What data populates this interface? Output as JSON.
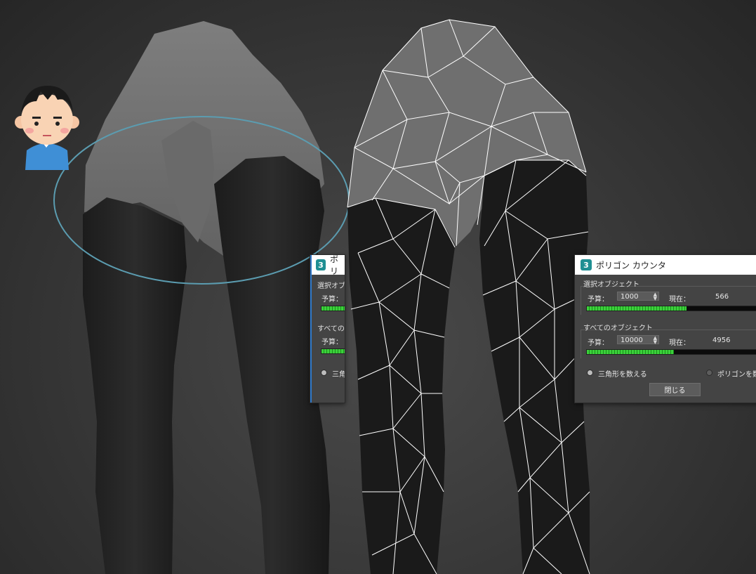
{
  "dialog": {
    "title": "ポリゴン カウンタ",
    "title_short": "ポリ",
    "app_icon": "3",
    "selected_group": "選択オブジェクト",
    "all_group": "すべてのオブジェクト",
    "all_group_short": "すべての",
    "budget_label": "予算：",
    "current_label": "現在：",
    "selected_budget": "1000",
    "selected_current": "566",
    "selected_progress": 0.566,
    "all_budget": "10000",
    "all_current": "4956",
    "all_progress": 0.4956,
    "count_triangles": "三角形を数える",
    "count_triangles_short": "三角",
    "count_polygons": "ポリゴンを数え",
    "close_button": "閉じる",
    "accent_color": "#3bd13b",
    "titlebar_color": "#ffffff",
    "icon_color": "#1f8f93"
  },
  "overlay": {
    "ellipse_color": "#5b9cb0",
    "avatar_icon": "person-avatar-icon"
  }
}
